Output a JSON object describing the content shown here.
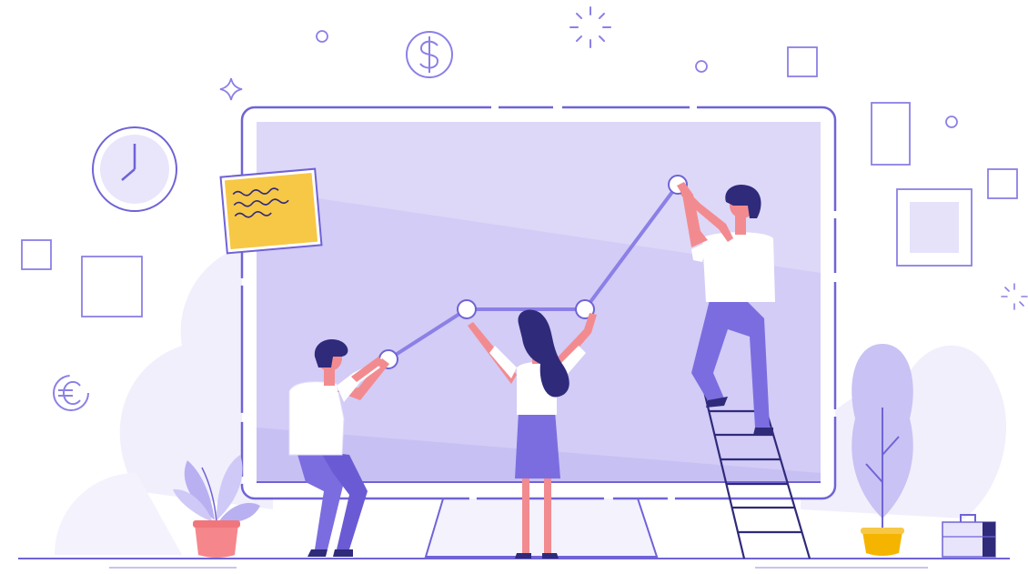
{
  "illustration": {
    "colors": {
      "background": "#ffffff",
      "bg_blob": "#f1effc",
      "line": "#6f63d6",
      "line_light": "#c9c3ef",
      "screen": "#ddd8f8",
      "screen_band": "#cbc3f4",
      "chart_line": "#8b80e6",
      "accent_yellow": "#f7c846",
      "shirt": "#ffffff",
      "pants": "#7b6de0",
      "skin": "#f28b90",
      "hair": "#2f2a7a",
      "pot_pink": "#f5878c",
      "pot_yellow": "#f5b400",
      "plant_purple": "#b9b0f2",
      "leaf_light": "#cfc9f7"
    },
    "icons": [
      "clock-icon",
      "dollar-coin-icon",
      "euro-icon",
      "sparkle-icon",
      "sun-burst-icon",
      "sticky-note-icon",
      "briefcase-icon",
      "ladder-icon",
      "plant-pink-pot-icon",
      "plant-yellow-pot-icon"
    ],
    "chart_nodes_count": 4
  }
}
